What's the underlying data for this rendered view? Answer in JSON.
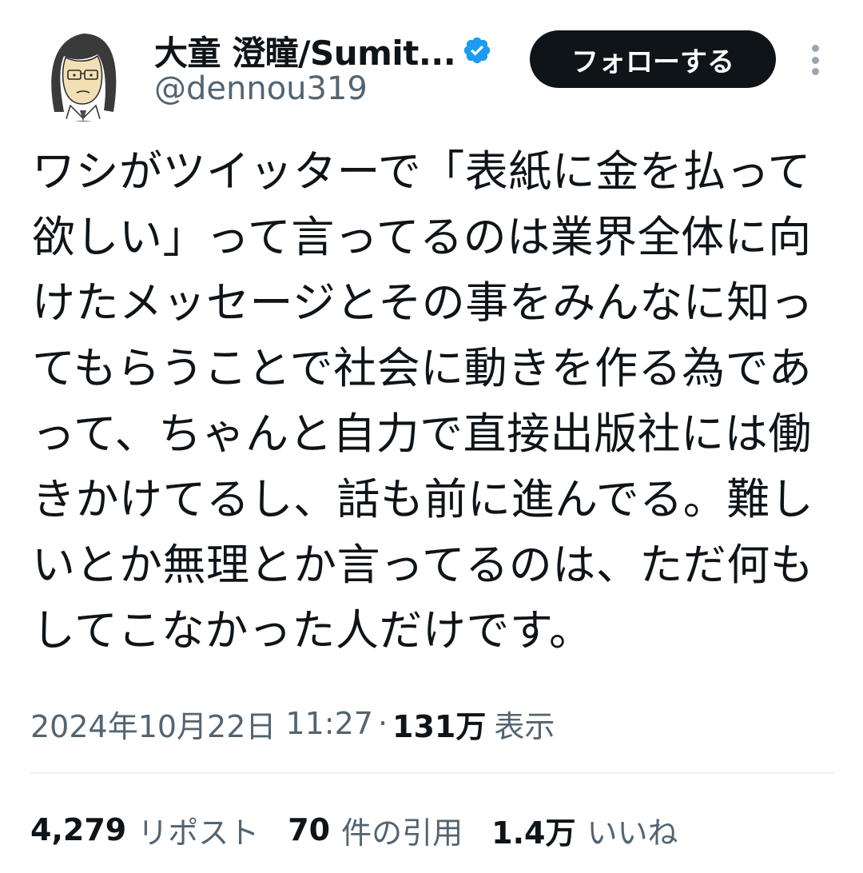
{
  "author": {
    "display_name": "大童 澄瞳/Sumit...",
    "handle": "@dennou319",
    "verified": true,
    "avatar_icon": "avatar-illustration"
  },
  "actions": {
    "follow_label": "フォローする",
    "more_icon": "more-vertical-icon"
  },
  "tweet": {
    "lines": [
      "ワシがツイッターで「表紙に金を払って",
      "欲しい」って言ってるのは業界全体に向",
      "けたメッセージとその事をみんなに知っ",
      "てもらうことで社会に動きを作る為であ",
      "って、ちゃんと自力で直接出版社には働",
      "きかけてるし、話も前に進んでる。難し",
      "いとか無理とか言ってるのは、ただ何も",
      "してこなかった人だけです。"
    ]
  },
  "meta": {
    "date": "2024年10月22日",
    "time": "11:27",
    "separator": "·",
    "views_count": "131万",
    "views_label": "表示"
  },
  "stats": [
    {
      "count": "4,279",
      "label": "リポスト"
    },
    {
      "count": "70",
      "label": "件の引用"
    },
    {
      "count": "1.4万",
      "label": "いいね"
    }
  ],
  "colors": {
    "text_primary": "#0f1419",
    "text_secondary": "#536471",
    "verified_blue": "#1d9bf0",
    "divider": "#eff3f4",
    "button_bg": "#0f1419"
  }
}
